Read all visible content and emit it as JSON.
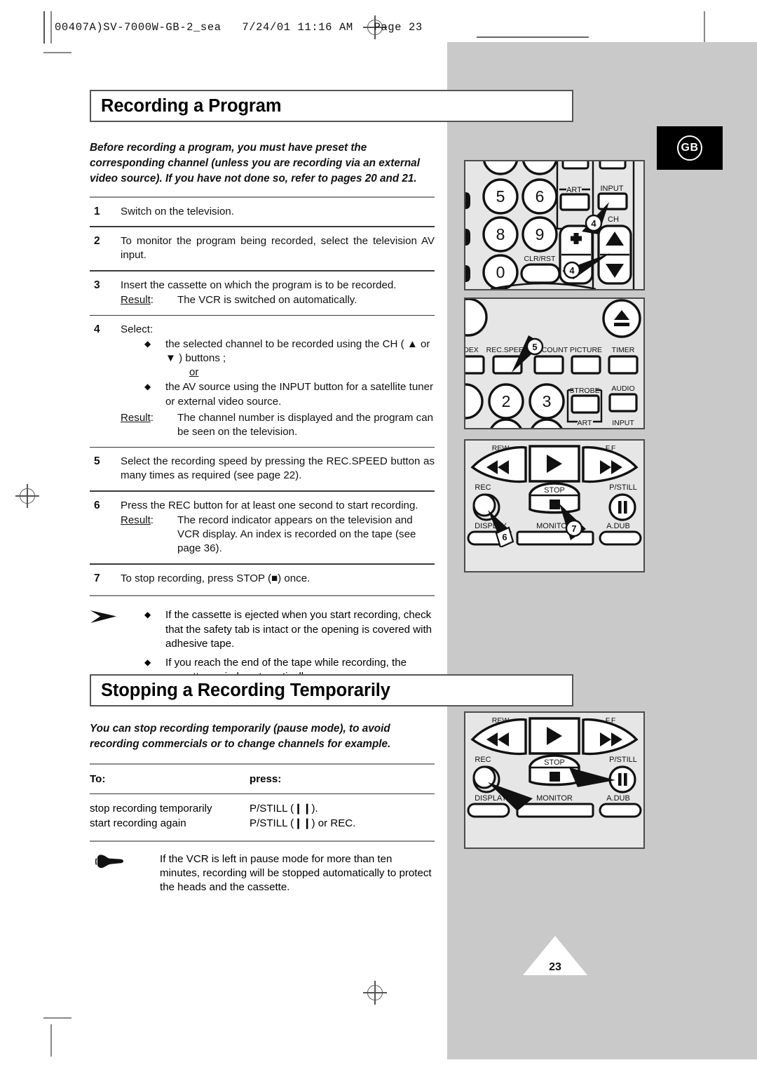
{
  "sheet": {
    "header_line": "00407A)SV-7000W-GB-2_sea   7/24/01 11:16 AM   Page 23",
    "region_badge": "GB",
    "page_number": "23"
  },
  "section1": {
    "title": "Recording a Program",
    "intro": "Before recording a program, you must have preset the corresponding channel (unless you are recording via an external video source). If you have not done so, refer to pages 20 and 21.",
    "steps": [
      {
        "num": "1",
        "text": "Switch on the television."
      },
      {
        "num": "2",
        "text": "To monitor the program being recorded, select the television AV input."
      },
      {
        "num": "3",
        "text": "Insert the cassette on which the program is to be recorded.",
        "result_label": "Result",
        "result_text": "The VCR is switched on automatically."
      },
      {
        "num": "4",
        "text": "Select:",
        "bullet1": "the selected channel to be recorded using the CH ( ▲ or ▼ ) buttons ;",
        "or_label": "or",
        "bullet2": "the AV source using the INPUT button for a satellite tuner or external video source.",
        "result_label": "Result",
        "result_text": "The channel number is displayed and the program can be seen on the television."
      },
      {
        "num": "5",
        "text": "Select the recording speed by pressing the REC.SPEED button as many times as required (see page 22)."
      },
      {
        "num": "6",
        "text": "Press the REC button for at least one second to start recording.",
        "result_label": "Result",
        "result_text": "The record indicator appears on the television and VCR display. An index is recorded on the tape (see page 36)."
      },
      {
        "num": "7",
        "text": "To stop recording, press STOP (■) once."
      }
    ],
    "notes": [
      "If the cassette is ejected when you start recording, check that the safety tab is intact or the opening is covered with adhesive tape.",
      "If you reach the end of the tape while recording, the cassette rewinds automatically."
    ],
    "note_icon": "arrowhead-icon"
  },
  "section2": {
    "title": "Stopping a Recording Temporarily",
    "intro": "You can stop recording temporarily (pause mode), to avoid recording commercials or to change channels for example.",
    "table": {
      "headers": [
        "To:",
        "press:"
      ],
      "rows": [
        [
          "stop recording temporarily",
          "P/STILL (❙❙)."
        ],
        [
          "start recording again",
          "P/STILL (❙❙) or REC."
        ]
      ]
    },
    "note": "If the VCR is left in pause mode for more than ten minutes, recording will be stopped automatically to protect the heads and the cassette.",
    "note_icon": "pointing-hand-icon"
  },
  "illustrations": {
    "remote_keypad": {
      "name": "remote-keypad-illustration",
      "keys": [
        "5",
        "6",
        "8",
        "9",
        "0"
      ],
      "clr_label": "CLR/RST",
      "art_label": "ART",
      "input_label": "INPUT",
      "ch_label": "CH",
      "plus_label": "+",
      "minus_label": "–",
      "callouts": [
        "4",
        "4"
      ]
    },
    "remote_functions": {
      "name": "remote-functions-illustration",
      "row1": [
        "DEX",
        "REC.SPEED",
        "EX/COUNT",
        "PICTURE",
        "TIMER"
      ],
      "strobe_label": "STROBE",
      "audio_label": "AUDIO",
      "art_label": "ART",
      "input_label": "INPUT",
      "keys": [
        "2",
        "3"
      ],
      "eject_label": "eject-icon",
      "callouts": [
        "5"
      ]
    },
    "transport_numbered": {
      "name": "vcr-transport-illustration-numbered",
      "rew_label": "REW",
      "ff_label": "F.F",
      "stop_label": "STOP",
      "rec_label": "REC",
      "pstill_label": "P/STILL",
      "display_label": "DISPLAY",
      "monitor_label": "MONITOR",
      "adub_label": "A.DUB",
      "callouts": [
        "6",
        "7"
      ]
    },
    "transport_plain": {
      "name": "vcr-transport-illustration",
      "rew_label": "REW",
      "ff_label": "F.F",
      "stop_label": "STOP",
      "rec_label": "REC",
      "pstill_label": "P/STILL",
      "display_label": "DISPLAY",
      "monitor_label": "MONITOR",
      "adub_label": "A.DUB",
      "callouts": []
    }
  },
  "colors": {
    "band_gray": "#c9c9c9",
    "panel_gray": "#e6e6e6",
    "rule_gray": "#8d8d8d",
    "ink": "#111111"
  }
}
